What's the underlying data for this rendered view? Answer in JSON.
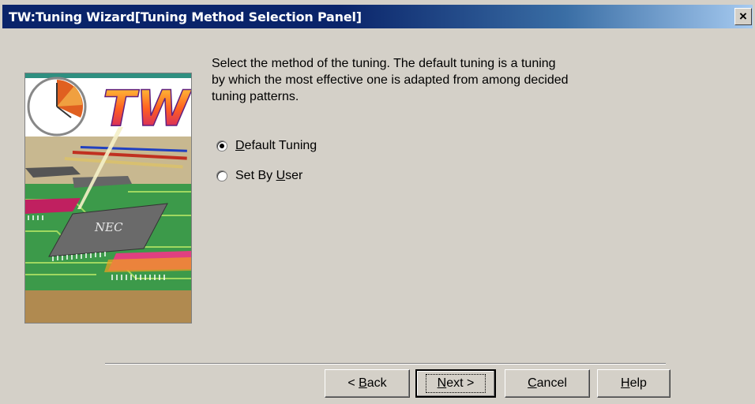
{
  "window": {
    "title": "TW:Tuning Wizard[Tuning Method Selection Panel]",
    "close_glyph": "×"
  },
  "image": {
    "logo_text": "TW",
    "chip_label": "NEC"
  },
  "description": {
    "lines": [
      "Select the method of the tuning. The default tuning is a tuning",
      "by which the most effective one is adapted from among decided",
      "tuning patterns."
    ]
  },
  "options": [
    {
      "label_pre": "",
      "label_mnemonic": "D",
      "label_post": "efault Tuning",
      "checked": true
    },
    {
      "label_pre": "Set By ",
      "label_mnemonic": "U",
      "label_post": "ser",
      "checked": false
    }
  ],
  "buttons": {
    "back": {
      "pre": "< ",
      "mnemonic": "B",
      "post": "ack"
    },
    "next": {
      "pre": "",
      "mnemonic": "N",
      "post": "ext >"
    },
    "cancel": {
      "pre": "",
      "mnemonic": "C",
      "post": "ancel"
    },
    "help": {
      "pre": "",
      "mnemonic": "H",
      "post": "elp"
    }
  }
}
